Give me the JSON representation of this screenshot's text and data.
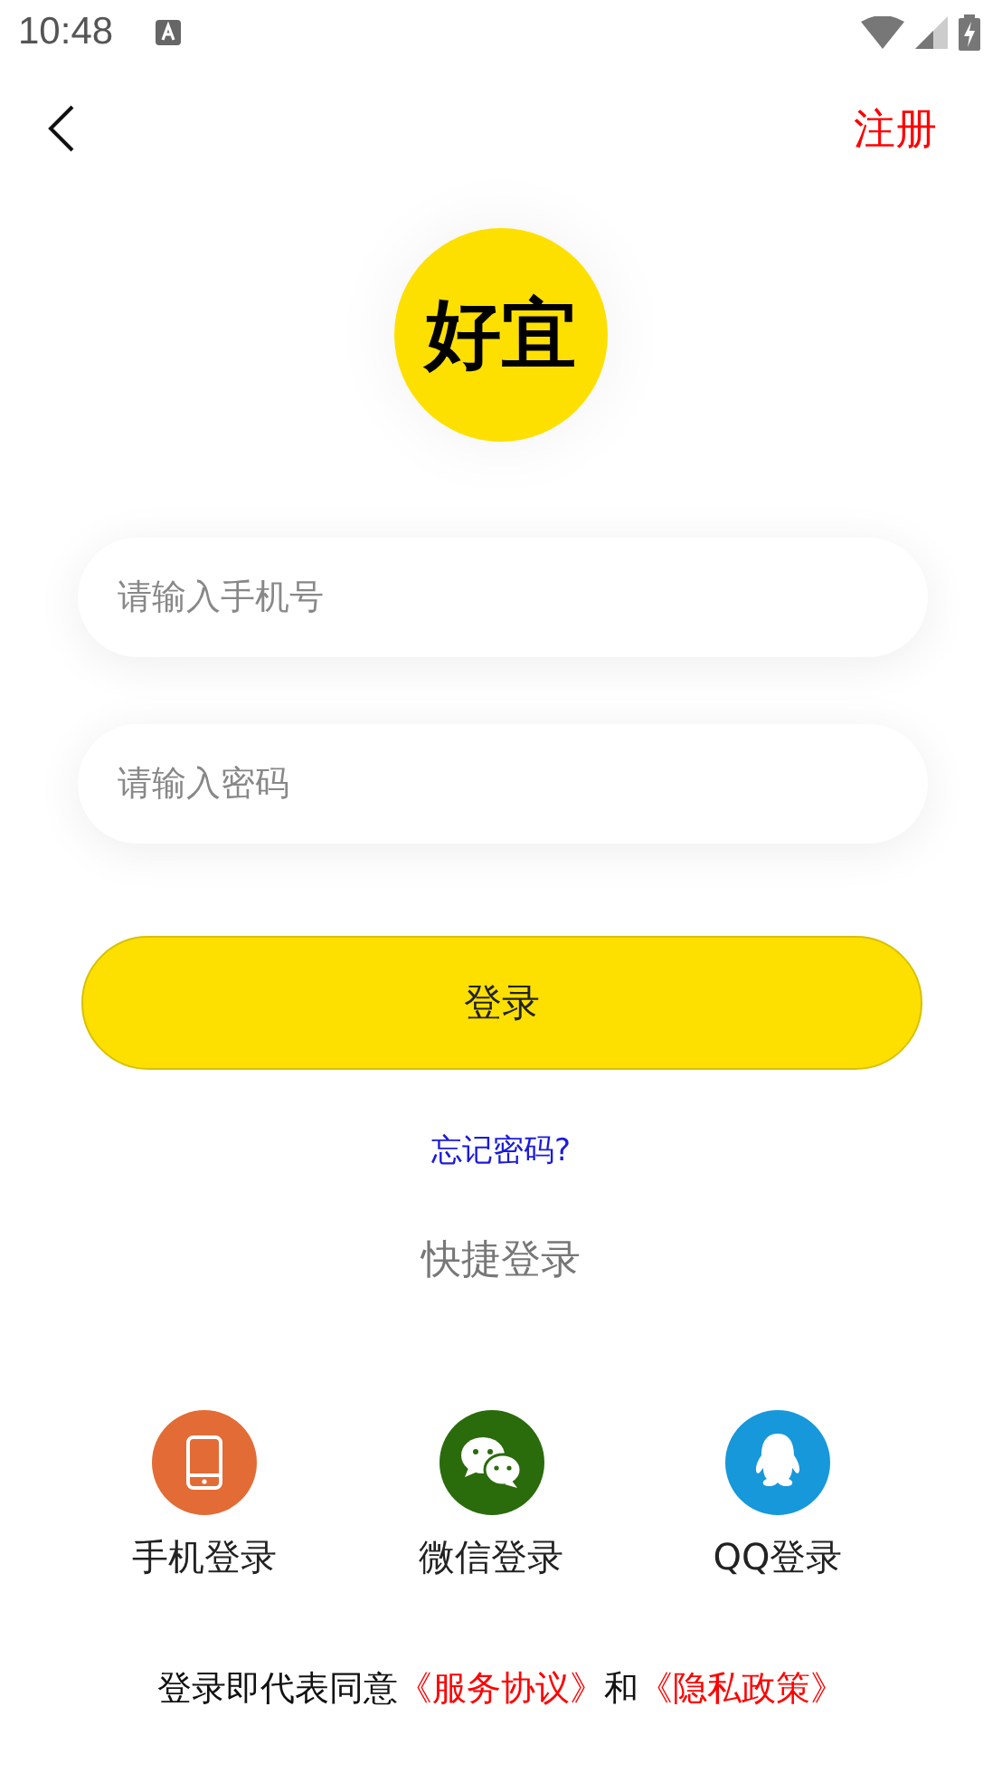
{
  "status_bar": {
    "time": "10:48"
  },
  "nav": {
    "action": "注册"
  },
  "logo": {
    "text": "好宜"
  },
  "fields": [
    {
      "placeholder": "请输入手机号"
    },
    {
      "placeholder": "请输入密码"
    }
  ],
  "login_button": "登录",
  "forgot_link": "忘记密码?",
  "quick_login": {
    "title": "快捷登录",
    "options": [
      {
        "label": "手机登录",
        "kind": "phone",
        "color": "#e36b35"
      },
      {
        "label": "微信登录",
        "kind": "wechat",
        "color": "#2a6b0c"
      },
      {
        "label": "QQ登录",
        "kind": "qq",
        "color": "#1698db"
      }
    ]
  },
  "agreement": {
    "prefix": "登录即代表同意",
    "link_1": "《服务协议》",
    "joiner": "和",
    "link_2": "《隐私政策》"
  }
}
